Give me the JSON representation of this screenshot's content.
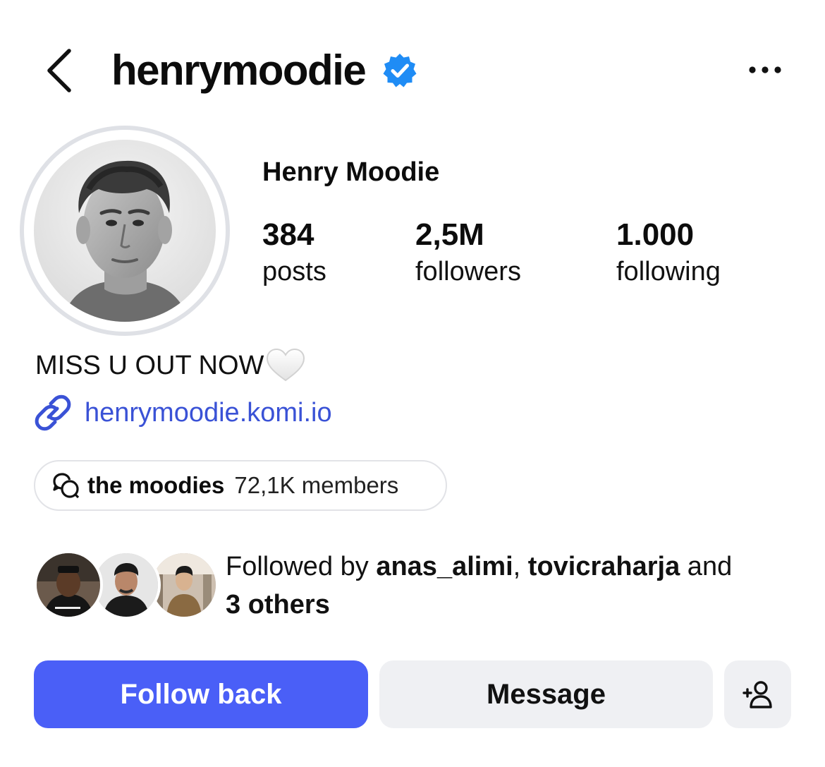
{
  "header": {
    "username": "henrymoodie",
    "verified_color": "#1f8cf5"
  },
  "profile": {
    "display_name": "Henry Moodie",
    "stats": [
      {
        "value": "384",
        "label": "posts"
      },
      {
        "value": "2,5M",
        "label": "followers"
      },
      {
        "value": "1.000",
        "label": "following"
      }
    ],
    "bio": "MISS U OUT NOW",
    "bio_emoji": "white-heart-icon",
    "link": "henrymoodie.komi.io",
    "link_color": "#3a52d6"
  },
  "channel": {
    "name": "the moodies",
    "members": "72,1K members"
  },
  "mutuals": {
    "prefix": "Followed by ",
    "user1": "anas_alimi",
    "separator": ", ",
    "user2": "tovicraharja",
    "connector": " and",
    "others": "3 others"
  },
  "actions": {
    "follow_label": "Follow back",
    "message_label": "Message",
    "follow_color": "#4a5ff7"
  }
}
